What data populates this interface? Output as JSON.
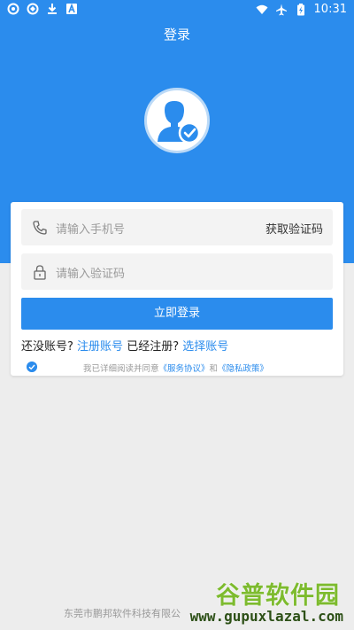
{
  "status_bar": {
    "time": "10:31"
  },
  "header": {
    "title": "登录"
  },
  "form": {
    "phone_placeholder": "请输入手机号",
    "get_code_label": "获取验证码",
    "code_placeholder": "请输入验证码",
    "login_label": "立即登录",
    "register_prompt": "还没账号?",
    "register_link": "注册账号",
    "registered_prompt": "已经注册?",
    "choose_link": "选择账号"
  },
  "agreement": {
    "prefix": "我已详细阅读并同意",
    "service_link": "《服务协议》",
    "and": "和",
    "privacy_link": "《隐私政策》"
  },
  "footer": {
    "company": "东莞市鹏邦软件科技有限公"
  },
  "watermark": {
    "line1": "谷普软件园",
    "line2": "www.gupuxlazal.com"
  },
  "colors": {
    "primary": "#2b8ced",
    "background": "#ededed"
  }
}
